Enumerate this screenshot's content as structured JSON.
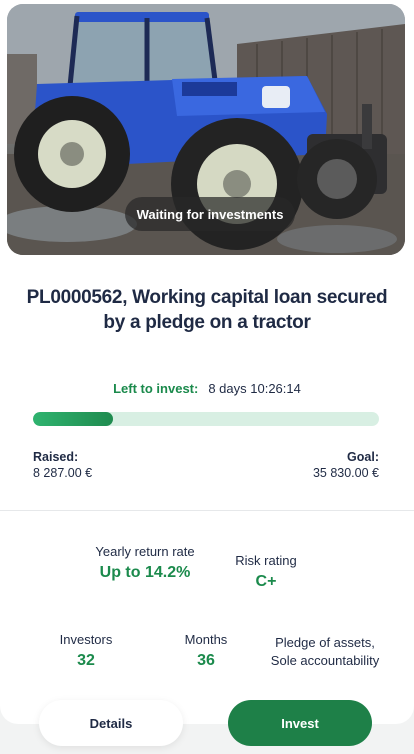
{
  "loan": {
    "status_badge": "Waiting for investments",
    "title": "PL0000562, Working capital loan secured by a pledge on a tractor",
    "left_to_invest_label": "Left to invest:",
    "left_to_invest_value": "8 days 10:26:14",
    "funded_fraction": 0.231,
    "raised_label": "Raised:",
    "raised_value": "8 287.00 €",
    "goal_label": "Goal:",
    "goal_value": "35 830.00 €"
  },
  "stats": {
    "return_label": "Yearly return rate",
    "return_value": "Up to 14.2%",
    "risk_label": "Risk rating",
    "risk_value": "C+",
    "investors_label": "Investors",
    "investors_value": "32",
    "months_label": "Months",
    "months_value": "36",
    "security_line1": "Pledge of assets,",
    "security_line2": "Sole accountability"
  },
  "actions": {
    "details_label": "Details",
    "invest_label": "Invest"
  },
  "colors": {
    "accent_green": "#1b8a4c",
    "invest_button": "#1e8048",
    "tractor_blue": "#2b54c9"
  }
}
